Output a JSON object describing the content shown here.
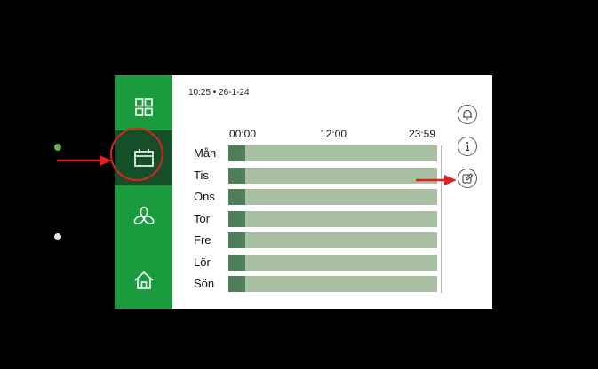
{
  "status": {
    "datetime": "10:25 • 26-1-24"
  },
  "schedule": {
    "time_labels": [
      "00:00",
      "12:00",
      "23:59"
    ],
    "days": [
      {
        "label": "Mån",
        "active_fraction": 0.08
      },
      {
        "label": "Tis",
        "active_fraction": 0.08
      },
      {
        "label": "Ons",
        "active_fraction": 0.08
      },
      {
        "label": "Tor",
        "active_fraction": 0.08
      },
      {
        "label": "Fre",
        "active_fraction": 0.08
      },
      {
        "label": "Lör",
        "active_fraction": 0.08
      },
      {
        "label": "Sön",
        "active_fraction": 0.08
      }
    ]
  },
  "sidebar": {
    "items": [
      {
        "icon": "grid-icon"
      },
      {
        "icon": "calendar-icon",
        "selected": true
      },
      {
        "icon": "fan-icon"
      },
      {
        "icon": "home-icon"
      }
    ]
  },
  "actions": [
    {
      "icon": "bell-icon"
    },
    {
      "icon": "info-icon"
    },
    {
      "icon": "edit-icon"
    }
  ],
  "colors": {
    "sidebar": "#1a9b3d",
    "sidebar_selected": "#154f27",
    "bar": "#a8bfa2",
    "bar_fill": "#4f7f58",
    "annotation": "#d22222"
  }
}
